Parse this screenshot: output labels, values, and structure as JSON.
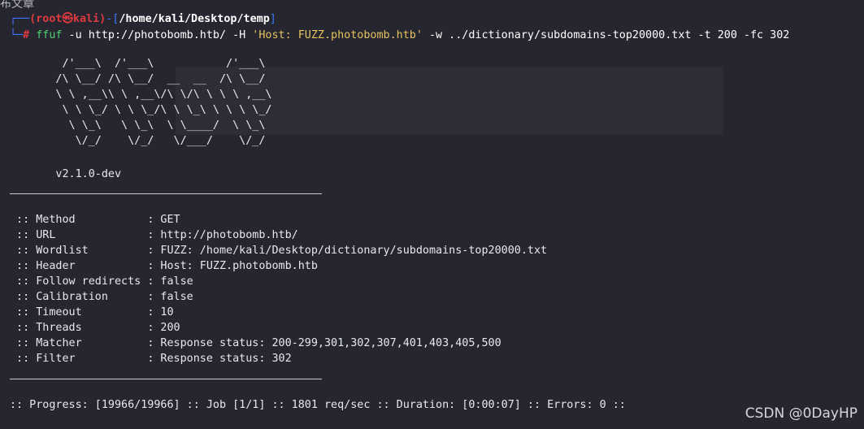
{
  "prompt": {
    "user": "(root㉿kali)",
    "path": "/home/kali/Desktop/temp",
    "hash": "#",
    "command_name": "ffuf",
    "command_args_1": " -u http://photobomb.htb/ -H ",
    "command_str": "'Host: FUZZ.photobomb.htb'",
    "command_args_2": " -w ../dictionary/subdomains-top20000.txt -t 200 -fc 302"
  },
  "banner": {
    "lines": [
      "        /'___\\  /'___\\           /'___\\",
      "       /\\ \\__/ /\\ \\__/  __  __  /\\ \\__/",
      "       \\ \\ ,__\\\\ \\ ,__\\/\\ \\/\\ \\ \\ \\ ,__\\",
      "        \\ \\ \\_/ \\ \\ \\_/\\ \\ \\_\\ \\ \\ \\ \\_/",
      "         \\ \\_\\   \\ \\_\\  \\ \\____/  \\ \\_\\",
      "          \\/_/    \\/_/   \\/___/    \\/_/"
    ],
    "version": "       v2.1.0-dev"
  },
  "options": [
    {
      "key": " :: Method           ",
      "value": ": GET"
    },
    {
      "key": " :: URL              ",
      "value": ": http://photobomb.htb/"
    },
    {
      "key": " :: Wordlist         ",
      "value": ": FUZZ: /home/kali/Desktop/dictionary/subdomains-top20000.txt"
    },
    {
      "key": " :: Header           ",
      "value": ": Host: FUZZ.photobomb.htb"
    },
    {
      "key": " :: Follow redirects ",
      "value": ": false"
    },
    {
      "key": " :: Calibration      ",
      "value": ": false"
    },
    {
      "key": " :: Timeout          ",
      "value": ": 10"
    },
    {
      "key": " :: Threads          ",
      "value": ": 200"
    },
    {
      "key": " :: Matcher          ",
      "value": ": Response status: 200-299,301,302,307,401,403,405,500"
    },
    {
      "key": " :: Filter           ",
      "value": ": Response status: 302"
    }
  ],
  "progress": ":: Progress: [19966/19966] :: Job [1/1] :: 1801 req/sec :: Duration: [0:00:07] :: Errors: 0 ::",
  "watermark": "CSDN @0DayHP",
  "top_fragment": "布文章",
  "colors": {
    "background": "#252630",
    "prompt_user": "#e0393e",
    "prompt_deco": "#3b78ff",
    "command": "#4fd16a",
    "string": "#e6c35c"
  }
}
